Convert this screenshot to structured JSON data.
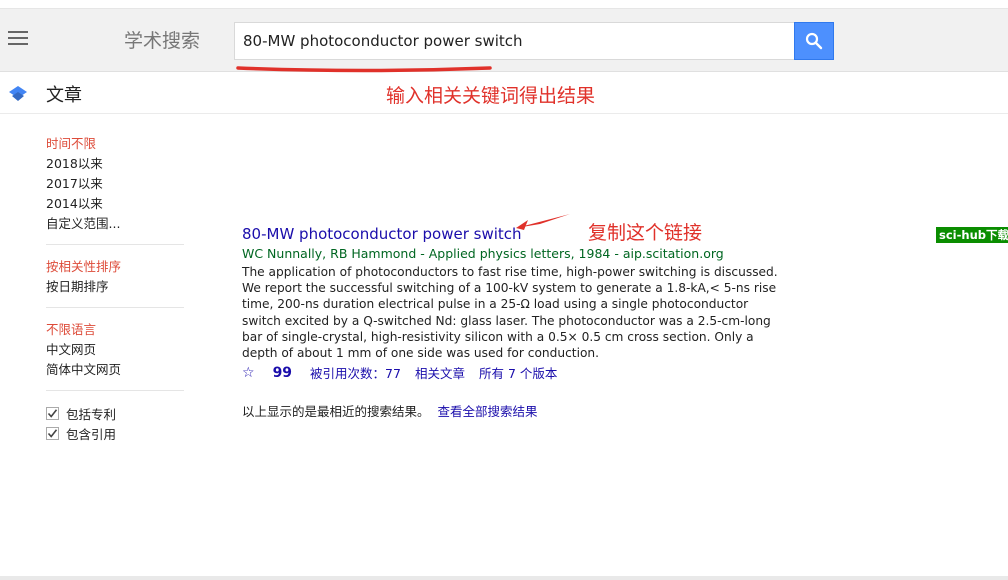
{
  "header": {
    "brand": "学术搜索",
    "search_value": "80-MW photoconductor power switch"
  },
  "subheader": {
    "section_title": "文章",
    "annotation": "输入相关关键词得出结果"
  },
  "sidebar": {
    "time_options": [
      "时间不限",
      "2018以来",
      "2017以来",
      "2014以来",
      "自定义范围..."
    ],
    "sort_options": [
      "按相关性排序",
      "按日期排序"
    ],
    "language_options": [
      "不限语言",
      "中文网页",
      "简体中文网页"
    ],
    "checkboxes": [
      {
        "label": "包括专利",
        "checked": true
      },
      {
        "label": "包含引用",
        "checked": true
      }
    ]
  },
  "result": {
    "title": "80-MW photoconductor power switch",
    "meta": "WC Nunnally, RB Hammond - Applied physics letters, 1984 - aip.scitation.org",
    "snippet": "The application of photoconductors to fast rise time, high-power switching is discussed. We report the successful switching of a 100-kV system to generate a 1.8-kA,< 5-ns rise time, 200-ns duration electrical pulse in a 25-Ω load using a single photoconductor switch excited by a Q-switched Nd: glass laser. The photoconductor was a 2.5-cm-long bar of single-crystal, high-resistivity silicon with a 0.5× 0.5 cm cross section. Only a depth of about 1 mm of one side was used for conduction.",
    "cited_by": "被引用次数：77",
    "related": "相关文章",
    "versions": "所有 7 个版本",
    "annotation": "复制这个链接"
  },
  "footer": {
    "text": "以上显示的是最相近的搜索结果。",
    "link": "查看全部搜索结果"
  },
  "scihub_label": "sci-hub下载",
  "colors": {
    "accent_blue": "#4d90fe",
    "annotation_red": "#e0312a",
    "link": "#1a0dab",
    "meta_green": "#006621",
    "active_red": "#dd4b39",
    "scihub_green": "#0a8d00"
  }
}
